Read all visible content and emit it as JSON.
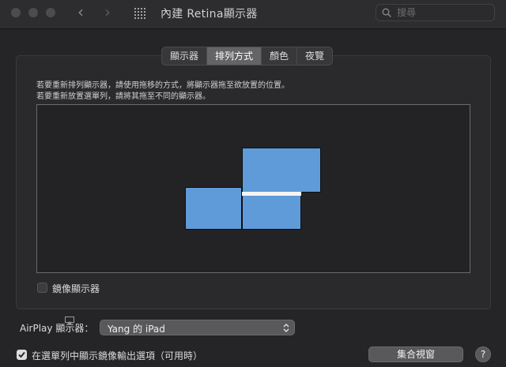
{
  "window": {
    "title": "內建 Retina顯示器",
    "nav_back_icon": "chevron-left-icon",
    "nav_forward_icon": "chevron-right-icon",
    "grid_icon": "show-all-grid-icon"
  },
  "search": {
    "placeholder": "搜尋",
    "icon": "search-icon"
  },
  "tabs": [
    {
      "label": "顯示器",
      "active": false
    },
    {
      "label": "排列方式",
      "active": true
    },
    {
      "label": "顏色",
      "active": false
    },
    {
      "label": "夜覽",
      "active": false
    }
  ],
  "arrangement": {
    "instruction_1": "若要重新排列顯示器，請使用拖移的方式，將顯示器拖至欲放置的位置。",
    "instruction_2": "若要重新放置選單列，請將其拖至不同的顯示器。",
    "display_color": "#5f9bd8",
    "mirror_checkbox": {
      "label": "鏡像顯示器",
      "checked": false
    }
  },
  "airplay": {
    "label": "AirPlay 顯示器：",
    "selected": "Yang 的 iPad",
    "icon": "airplay-icon"
  },
  "footer": {
    "menu_option": {
      "label": "在選單列中顯示鏡像輸出選項（可用時）",
      "checked": true
    },
    "gather_button": "集合視窗",
    "help_button": "?"
  },
  "colors": {
    "accent_display": "#5f9bd8",
    "background": "#252527"
  }
}
